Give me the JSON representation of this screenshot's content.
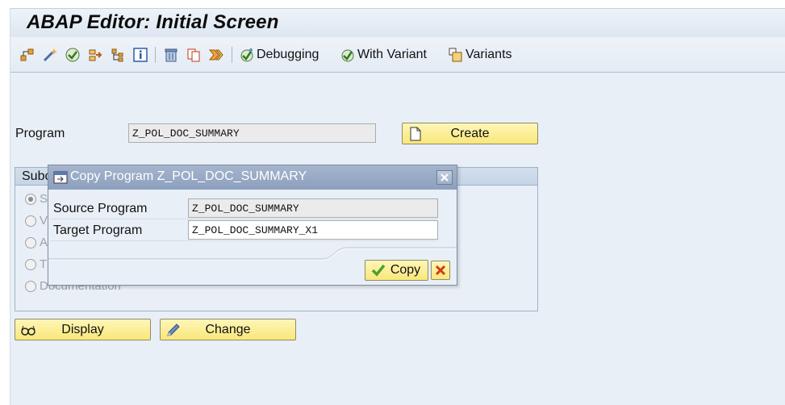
{
  "window": {
    "title": "ABAP Editor: Initial Screen"
  },
  "toolbar": {
    "icons": [
      "hierarchy-icon",
      "magic-wand-icon",
      "check-icon",
      "where-used-icon",
      "tree-icon",
      "info-icon",
      "trash-icon",
      "copy-icon",
      "activate-icon"
    ],
    "debugging_label": "Debugging",
    "with_variant_label": "With Variant",
    "variants_label": "Variants"
  },
  "form": {
    "program_label": "Program",
    "program_value": "Z_POL_DOC_SUMMARY",
    "create_label": "Create",
    "display_label": "Display",
    "change_label": "Change"
  },
  "subobjects": {
    "heading_visible": "Subc",
    "items": [
      {
        "visible": "S",
        "checked": true
      },
      {
        "visible": "V",
        "checked": false
      },
      {
        "visible": "A",
        "checked": false
      },
      {
        "visible": "T",
        "checked": false
      },
      {
        "visible": "Documentation",
        "checked": false
      }
    ]
  },
  "dialog": {
    "title": "Copy Program Z_POL_DOC_SUMMARY",
    "source_label": "Source Program",
    "source_value": "Z_POL_DOC_SUMMARY",
    "target_label": "Target Program",
    "target_value": "Z_POL_DOC_SUMMARY_X1",
    "copy_label": "Copy"
  },
  "colors": {
    "button_yellow": "#f9e77a",
    "dialog_title": "#8c9fbd",
    "background": "#e9eff6",
    "cancel_red": "#d33a1c",
    "check_green": "#4aa22e"
  }
}
